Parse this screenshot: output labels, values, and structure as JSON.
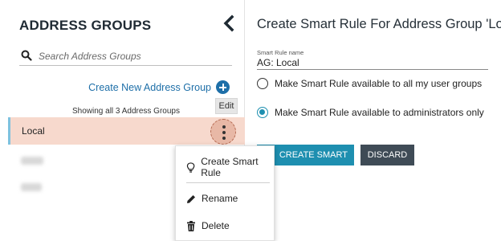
{
  "left_panel": {
    "title": "ADDRESS GROUPS",
    "search_placeholder": "Search Address Groups",
    "create_group_label": "Create New Address Group",
    "showing_text": "Showing all 3 Address Groups",
    "edit_label": "Edit",
    "groups": [
      {
        "label": "Local",
        "selected": true
      },
      {
        "label": "",
        "blurred": true
      },
      {
        "label": "",
        "blurred": true
      }
    ]
  },
  "context_menu": {
    "items": [
      {
        "label": "Create Smart Rule",
        "icon": "lightbulb-icon"
      },
      {
        "label": "Rename",
        "icon": "pencil-icon"
      },
      {
        "label": "Delete",
        "icon": "trash-icon"
      }
    ]
  },
  "right_panel": {
    "title": "Create Smart Rule For Address Group 'Local'",
    "rule_name_label": "Smart Rule name",
    "rule_name_value": "AG: Local",
    "options": [
      {
        "label": "Make Smart Rule available to all my user groups",
        "selected": false
      },
      {
        "label": "Make Smart Rule available to administrators only",
        "selected": true
      }
    ],
    "create_button": "CREATE SMART RULE",
    "discard_button": "DISCARD"
  },
  "colors": {
    "accent": "#1e8fb0",
    "link": "#1e6fa8",
    "selected_row": "#f7d9cd",
    "discard": "#3f4b56"
  }
}
